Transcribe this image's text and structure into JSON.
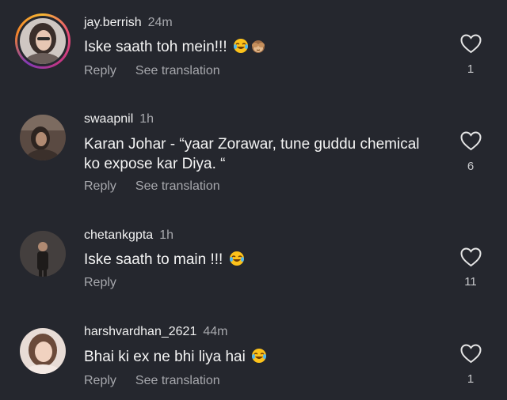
{
  "comments": [
    {
      "username": "jay.berrish",
      "time": "24m",
      "text": "Iske saath toh mein!!!",
      "emojis": [
        "face-with-tears-of-joy-emoji",
        "see-no-evil-monkey-emoji"
      ],
      "reply_label": "Reply",
      "translation_label": "See translation",
      "likes": "1",
      "has_story_ring": true
    },
    {
      "username": "swaapnil",
      "time": "1h",
      "text_line1": "Karan Johar - “yaar Zorawar, tune guddu chemical",
      "text_line2": "ko expose kar Diya. “",
      "emojis": [],
      "reply_label": "Reply",
      "translation_label": "See translation",
      "likes": "6",
      "has_story_ring": false
    },
    {
      "username": "chetankgpta",
      "time": "1h",
      "text": "Iske saath to main !!!",
      "emojis": [
        "face-with-tears-of-joy-emoji"
      ],
      "reply_label": "Reply",
      "likes": "11",
      "has_story_ring": false
    },
    {
      "username": "harshvardhan_2621",
      "time": "44m",
      "text": "Bhai ki ex ne bhi liya hai",
      "emojis": [
        "face-with-tears-of-joy-emoji"
      ],
      "reply_label": "Reply",
      "translation_label": "See translation",
      "likes": "1",
      "has_story_ring": false
    }
  ],
  "icons": {
    "like": "heart-outline-icon"
  },
  "colors": {
    "background": "#25272e",
    "primary_text": "#f2f2f2",
    "secondary_text": "#a7a8ad"
  }
}
